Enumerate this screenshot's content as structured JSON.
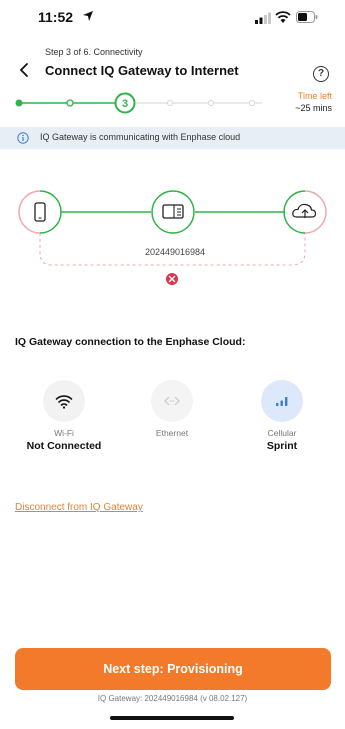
{
  "status_bar": {
    "time": "11:52"
  },
  "header": {
    "step": "Step 3 of 6. Connectivity",
    "title": "Connect IQ Gateway to Internet",
    "help_icon": "?"
  },
  "progress": {
    "current_step": "3",
    "total_steps": 6,
    "time_left_label": "Time left",
    "time_left_value": "~25 mins"
  },
  "info_banner": {
    "text": "IQ Gateway is communicating with Enphase cloud"
  },
  "diagram": {
    "gateway_serial": "202449016984"
  },
  "connection": {
    "title": "IQ Gateway connection to the Enphase Cloud:",
    "options": [
      {
        "label": "Wi-Fi",
        "status": "Not Connected",
        "icon": "wifi-icon"
      },
      {
        "label": "Ethernet",
        "status": "",
        "icon": "ethernet-icon"
      },
      {
        "label": "Cellular",
        "status": "Sprint",
        "icon": "cellular-icon"
      }
    ]
  },
  "actions": {
    "disconnect": "Disconnect from IQ Gateway",
    "next": "Next step: Provisioning"
  },
  "footer": {
    "text": "IQ Gateway: 202449016984 (v 08.02.127)"
  },
  "colors": {
    "accent_orange": "#f37a2a",
    "success_green": "#2db548",
    "error_red": "#e0334a",
    "cellular_blue": "#3a7bd5"
  }
}
